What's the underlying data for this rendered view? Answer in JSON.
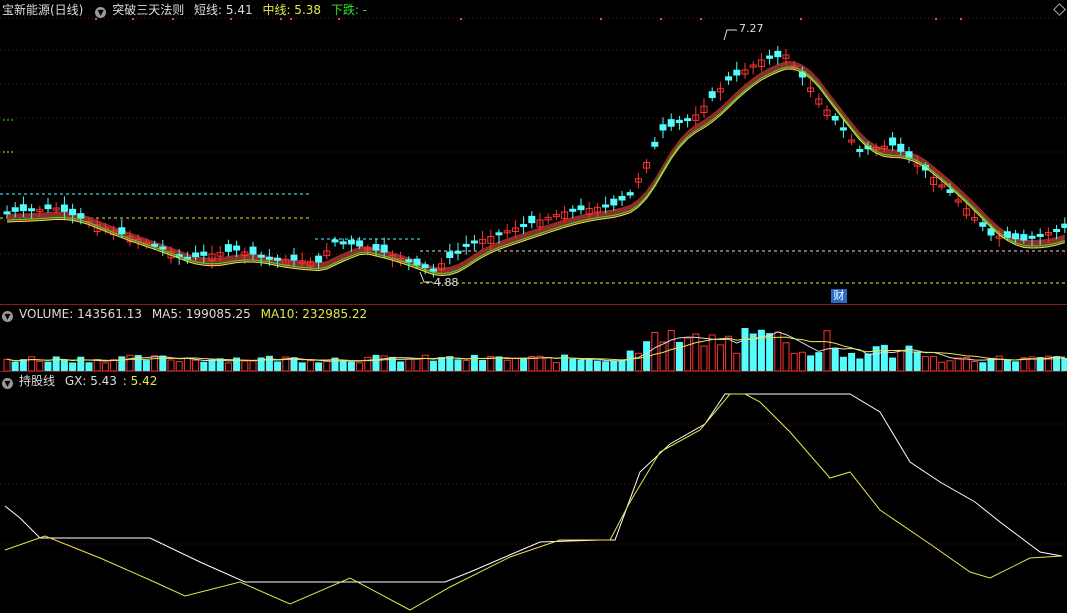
{
  "main_header": {
    "stock_name": "宝新能源(日线)",
    "indicator_name": "突破三天法则",
    "short_label": "短线: 5.41",
    "mid_label": "中线: 5.38",
    "trend_label": "下跌: -"
  },
  "annotations": {
    "high_price": "7.27",
    "low_price": "4.88",
    "fin_marker": "财"
  },
  "volume_header": {
    "volume": "VOLUME: 143561.13",
    "ma5": "MA5: 199085.25",
    "ma10": "MA10: 232985.22"
  },
  "gx_header": {
    "name": "持股线",
    "gx": "GX: 5.43",
    "gx2": ": 5.42"
  },
  "colors": {
    "background": "#000000",
    "up": "#ff3333",
    "down": "#54fcfc",
    "ribbon": "#a0302c",
    "ma_yellow": "#e6e64c",
    "ma_green": "#2ee62e",
    "grid": "#7a1010",
    "white_line": "#ffffff"
  },
  "icons": [
    "chevron-down-icon",
    "diamond-icon"
  ]
}
